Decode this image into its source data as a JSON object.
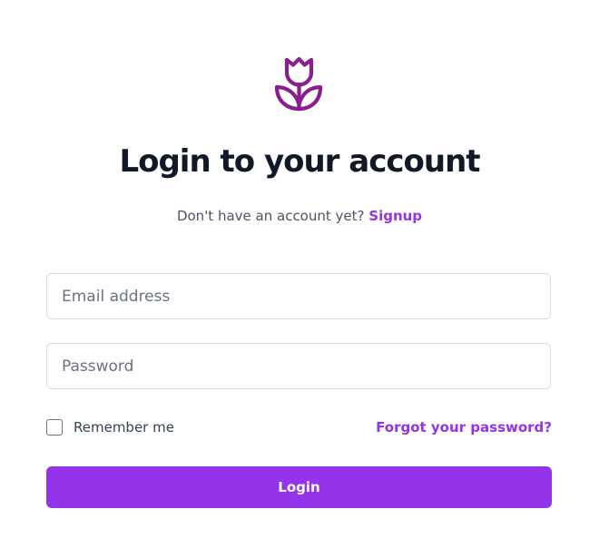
{
  "brand": {
    "logo_icon": "tulip-icon",
    "accent_color": "#9333ea"
  },
  "heading": {
    "title": "Login to your account"
  },
  "signup_prompt": {
    "text": "Don't have an account yet?",
    "link_label": "Signup"
  },
  "form": {
    "email": {
      "placeholder": "Email address",
      "value": ""
    },
    "password": {
      "placeholder": "Password",
      "value": ""
    },
    "remember_me": {
      "label": "Remember me",
      "checked": false
    },
    "forgot_password_label": "Forgot your password?",
    "submit_label": "Login"
  }
}
